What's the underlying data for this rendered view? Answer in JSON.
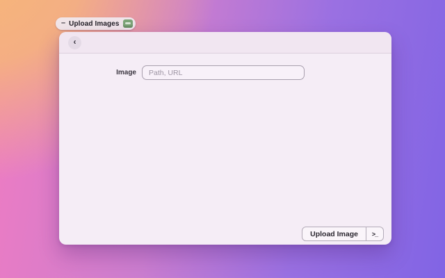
{
  "colors": {
    "gradient_orange": "#f6b778",
    "gradient_pink": "#f07cc2",
    "gradient_purple": "#8164e4",
    "panel_background": "#f5edf6",
    "app_icon_green": "#7ca477"
  },
  "window_chip": {
    "minimize_glyph": "–",
    "title": "Upload Images",
    "app_icon": "green-rounded-square-badge"
  },
  "panel": {
    "header": {
      "back_glyph": "‹"
    },
    "form": {
      "image_label": "Image",
      "image_placeholder": "Path, URL",
      "image_value": ""
    },
    "footer": {
      "upload_button_label": "Upload Image",
      "terminal_glyph": ">_"
    }
  }
}
